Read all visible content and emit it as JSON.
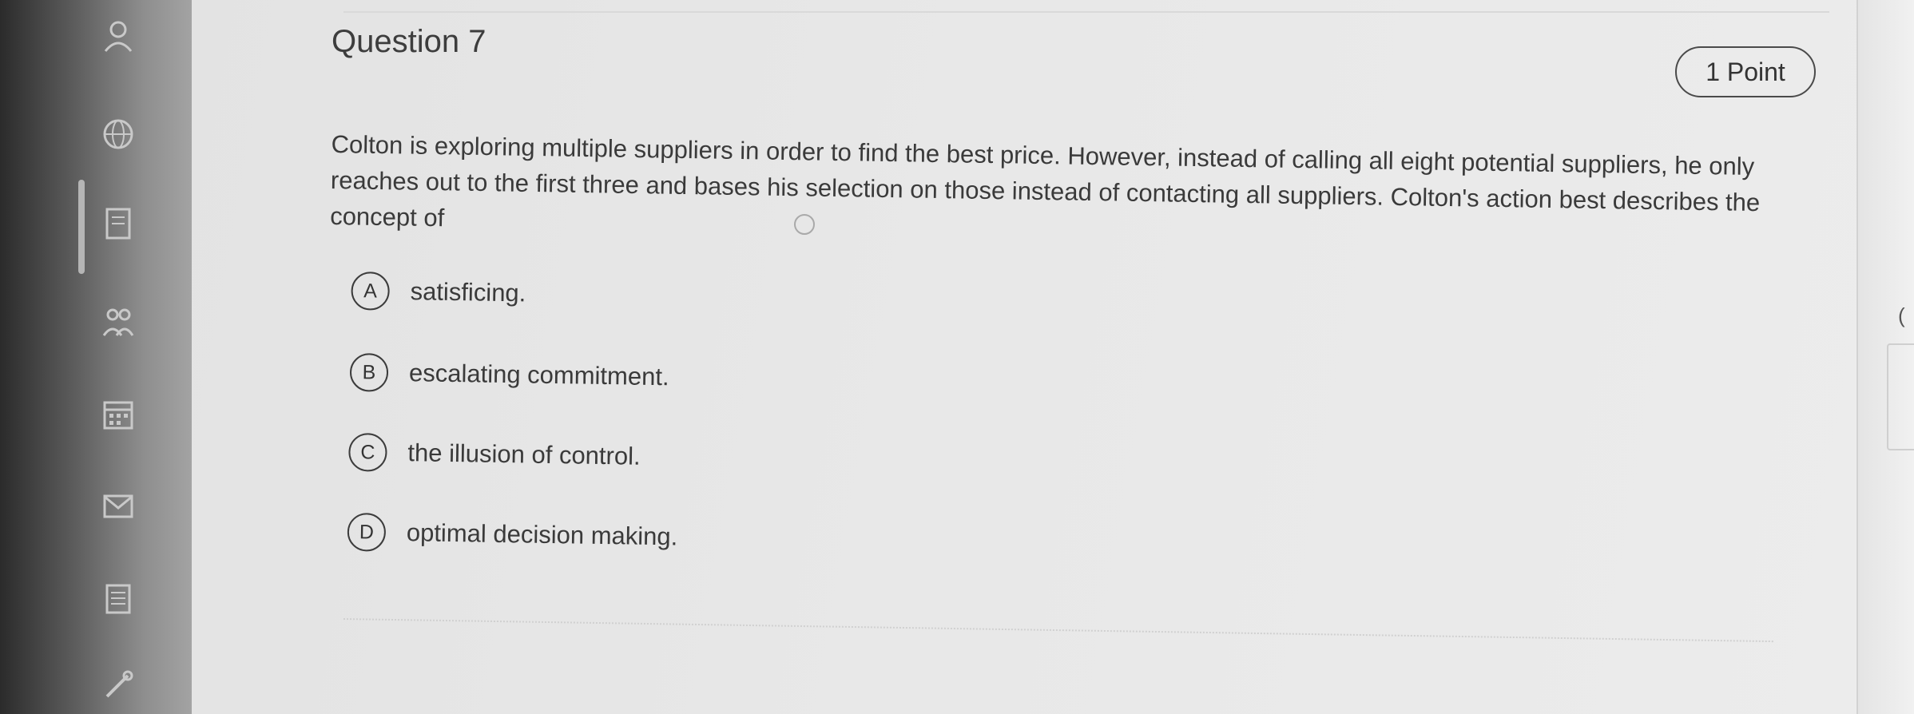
{
  "question": {
    "title": "Question 7",
    "points": "1 Point",
    "text": "Colton is exploring multiple suppliers in order to find the best price. However, instead of calling all eight potential suppliers, he only reaches out to the first three and bases his selection on those instead of contacting all suppliers. Colton's action best describes the concept of",
    "options": [
      {
        "letter": "A",
        "text": "satisficing."
      },
      {
        "letter": "B",
        "text": "escalating commitment."
      },
      {
        "letter": "C",
        "text": "the illusion of control."
      },
      {
        "letter": "D",
        "text": "optimal decision making."
      }
    ]
  },
  "sidebar": {
    "icons": [
      "user-icon",
      "globe-icon",
      "document-icon",
      "people-icon",
      "calendar-icon",
      "mail-icon",
      "notes-icon",
      "tools-icon"
    ]
  },
  "right_edge": {
    "fragment": "("
  }
}
